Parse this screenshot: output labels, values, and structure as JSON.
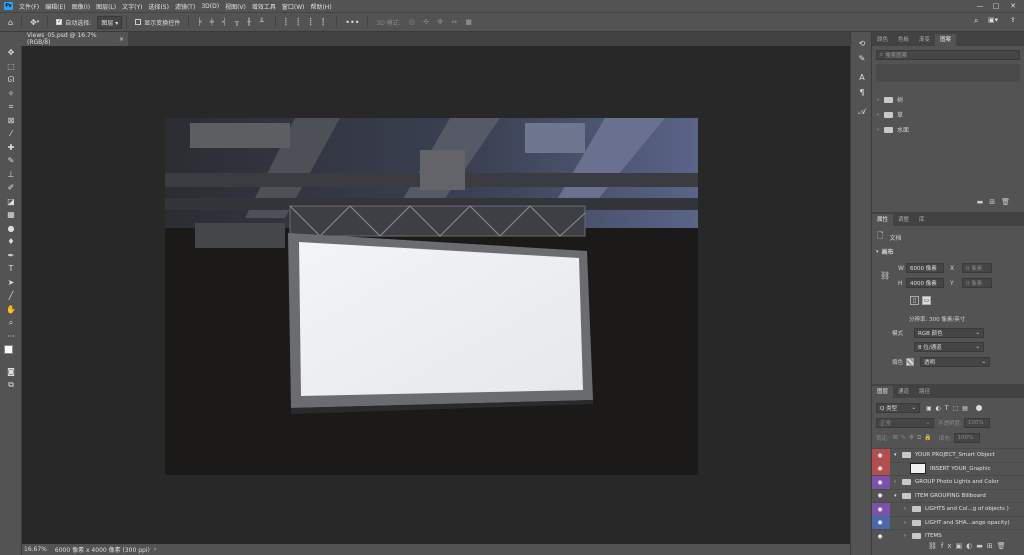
{
  "menu": {
    "logo": "Ps",
    "items": [
      "文件(F)",
      "编辑(E)",
      "图像(I)",
      "图层(L)",
      "文字(Y)",
      "选择(S)",
      "滤镜(T)",
      "3D(D)",
      "视图(V)",
      "增效工具",
      "窗口(W)",
      "帮助(H)"
    ]
  },
  "options": {
    "auto_select": "自动选择:",
    "layer_select": "图层",
    "show_transform": "显示变换控件",
    "mode3d": "3D 模式:"
  },
  "document": {
    "tab": "Views_05.psd @ 16.7%(RGB/8)",
    "close": "×"
  },
  "status": {
    "zoom": "16.67%",
    "info": "6000 像素 x 4000 像素 (300 ppi)"
  },
  "swatch_panel": {
    "tabs": [
      "颜色",
      "色板",
      "渐变",
      "图案"
    ],
    "search_placeholder": "搜索图案",
    "groups": [
      "树",
      "草",
      "水面"
    ]
  },
  "properties": {
    "tabs": [
      "属性",
      "调整",
      "库"
    ],
    "doc_label": "文档",
    "canvas_label": "画布",
    "w_label": "W",
    "w_value": "6000 像素",
    "h_label": "H",
    "h_value": "4000 像素",
    "x_label": "X",
    "x_value": "0 像素",
    "y_label": "Y",
    "y_value": "0 像素",
    "resolution": "分辨率: 300 像素/英寸",
    "mode_label": "模式",
    "mode_value": "RGB 颜色",
    "depth_value": "8 位/通道",
    "fill_label": "填色",
    "fill_value": "透明"
  },
  "layers": {
    "tabs": [
      "图层",
      "通道",
      "路径"
    ],
    "filter_kind": "Q 类型",
    "blend_mode": "正常",
    "opacity_label": "不透明度:",
    "opacity_value": "100%",
    "lock_label": "锁定:",
    "fill_label": "填充:",
    "fill_value": "100%",
    "rows": [
      {
        "name": "YOUR PROJECT_Smart Object",
        "color": "#b44d4d",
        "type": "group",
        "indent": 0,
        "expanded": true
      },
      {
        "name": "INSERT YOUR_Graphic",
        "color": "#b44d4d",
        "type": "smart",
        "indent": 1,
        "expanded": false
      },
      {
        "name": "GROUP Photo Lights and Color",
        "color": "#7a52a8",
        "type": "group",
        "indent": 0,
        "expanded": false
      },
      {
        "name": "ITEM GROUPING Billboard",
        "color": "",
        "type": "group",
        "indent": 0,
        "expanded": true
      },
      {
        "name": "LIGHTS and Col...g of objects )",
        "color": "#7a52a8",
        "type": "group",
        "indent": 1,
        "expanded": false
      },
      {
        "name": "LIGHT and SHA...ange opacity)",
        "color": "#4a67a8",
        "type": "group",
        "indent": 1,
        "expanded": false
      },
      {
        "name": "ITEMS",
        "color": "",
        "type": "group",
        "indent": 1,
        "expanded": false
      }
    ]
  }
}
